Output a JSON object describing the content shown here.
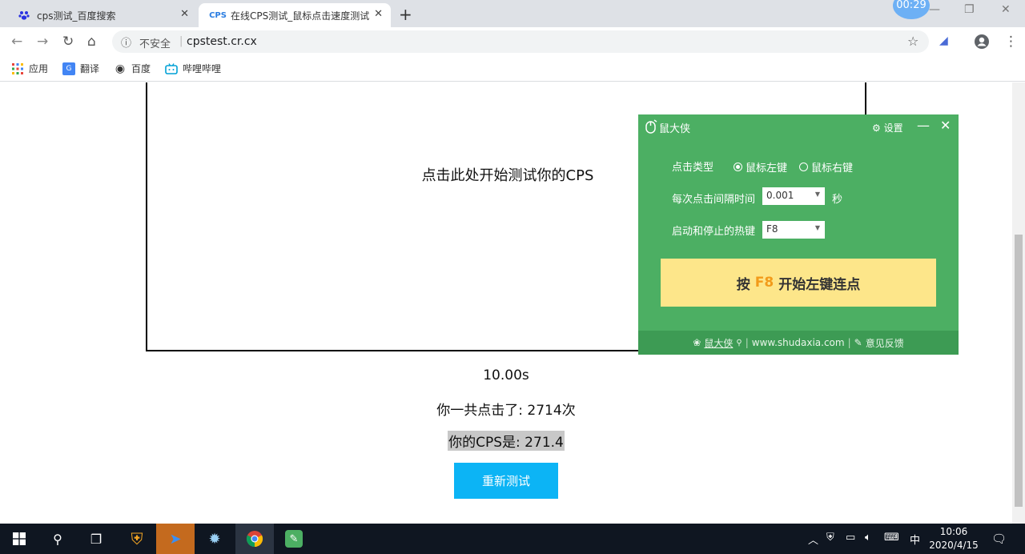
{
  "browser": {
    "tabs": [
      {
        "title": "cps测试_百度搜索",
        "active": false
      },
      {
        "title": "在线CPS测试_鼠标点击速度测试",
        "active": true,
        "favicon": "CPS"
      }
    ],
    "new_tab": "+",
    "insecure_label": "不安全",
    "url": "cpstest.cr.cx",
    "timer_badge": "00:29",
    "bookmarks": [
      {
        "label": "应用",
        "icon": "apps-grid-icon"
      },
      {
        "label": "翻译",
        "icon": "translate-icon"
      },
      {
        "label": "百度",
        "icon": "globe-icon"
      },
      {
        "label": "哔哩哔哩",
        "icon": "bilibili-icon"
      }
    ]
  },
  "page": {
    "click_prompt": "点击此处开始测试你的CPS",
    "time": "10.00s",
    "total_clicks": "你一共点击了: 2714次",
    "cps": "你的CPS是: 271.4",
    "retry_label": "重新测试"
  },
  "tool": {
    "title": "鼠大侠",
    "settings_label": "设置",
    "click_type_label": "点击类型",
    "left_option": "鼠标左键",
    "right_option": "鼠标右键",
    "selected": "left",
    "interval_label": "每次点击间隔时间",
    "interval_value": "0.001",
    "interval_unit": "秒",
    "hotkey_label": "启动和停止的热键",
    "hotkey_value": "F8",
    "start_prefix": "按",
    "start_key": "F8",
    "start_suffix": "开始左键连点",
    "footer_brand": "鼠大侠",
    "footer_site": "www.shudaxia.com",
    "footer_feedback": "意见反馈",
    "colors": {
      "panel": "#4caf63",
      "button": "#fde68a",
      "key": "#f29b1a"
    }
  },
  "taskbar": {
    "time": "10:06",
    "date": "2020/4/15",
    "ime": "中"
  }
}
